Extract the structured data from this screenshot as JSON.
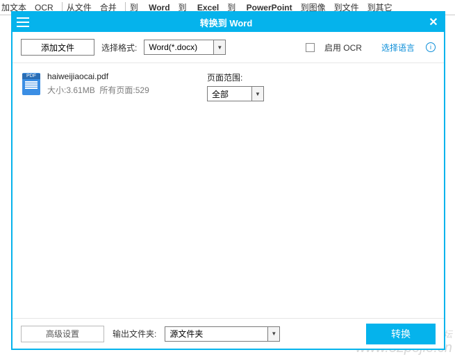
{
  "bgToolbar": {
    "items": [
      "加文本",
      "OCR",
      "从文件",
      "合并",
      "到",
      "到",
      "到",
      "到图像",
      "到文件",
      "到其它"
    ],
    "word": "Word",
    "excel": "Excel",
    "ppt": "PowerPoint"
  },
  "watermark": {
    "cn": "吾爱破解论坛",
    "en": "www.52pojie.cn"
  },
  "dialog": {
    "title": "转换到 Word",
    "addFile": "添加文件",
    "formatLabel": "选择格式:",
    "formatValue": "Word(*.docx)",
    "enableOCR": "启用 OCR",
    "selectLang": "选择语言",
    "file": {
      "name": "haiweijiaocai.pdf",
      "sizeLabel": "大小:",
      "size": "3.61MB",
      "pagesLabel": "所有页面:",
      "pages": "529"
    },
    "rangeLabel": "页面范围:",
    "rangeValue": "全部",
    "advanced": "高级设置",
    "outputLabel": "输出文件夹:",
    "outputValue": "源文件夹",
    "convert": "转换"
  }
}
